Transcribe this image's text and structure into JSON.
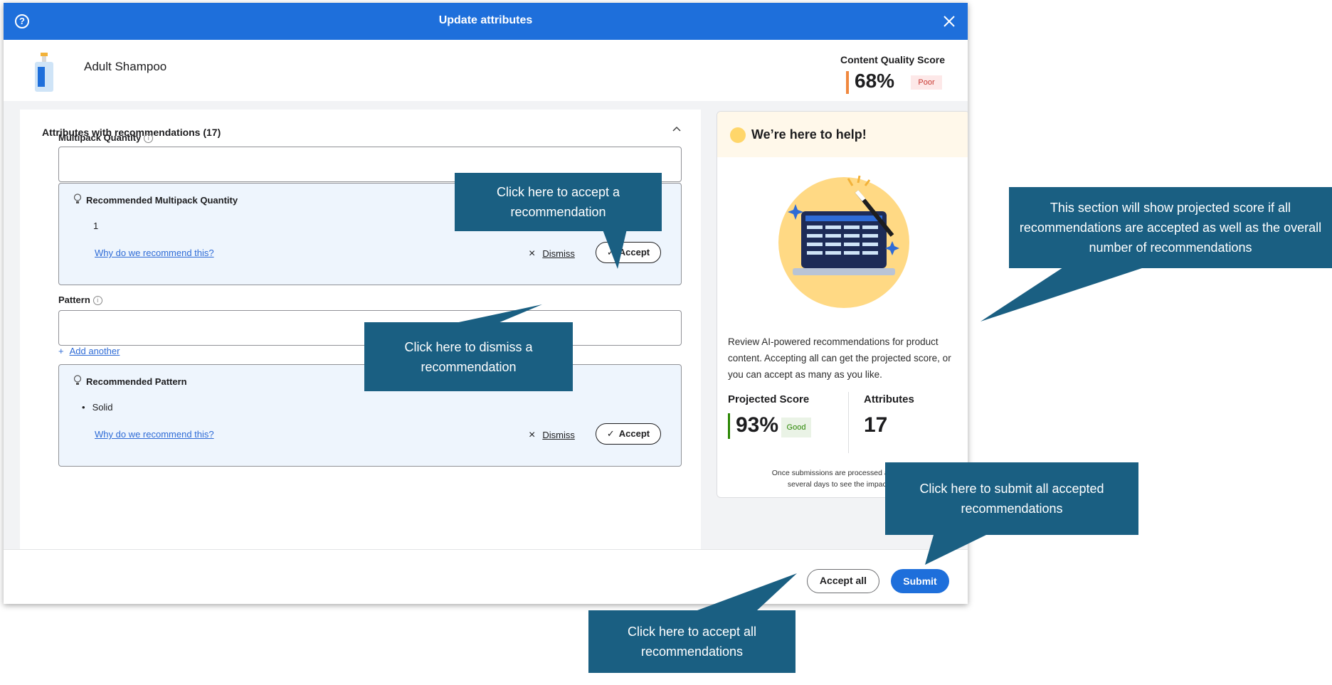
{
  "modal": {
    "title": "Update attributes",
    "help_icon": "?",
    "close_icon": "close-icon"
  },
  "product": {
    "name": "Adult Shampoo",
    "image_icon": "shampoo-bottle-icon"
  },
  "quality": {
    "label": "Content Quality Score",
    "value": "68%",
    "rating": "Poor",
    "color": "#f0883e"
  },
  "attributes": {
    "section_title": "Attributes with recommendations (17)",
    "fields": [
      {
        "label": "Multipack Quantity",
        "recommendation_title": "Recommended Multipack Quantity",
        "recommended_value": "1",
        "why_link": "Why do we recommend this?",
        "dismiss_label": "Dismiss",
        "accept_label": "Accept"
      },
      {
        "label": "Pattern",
        "add_another": "Add another",
        "recommendation_title": "Recommended Pattern",
        "recommended_value": "Solid",
        "why_link": "Why do we recommend this?",
        "dismiss_label": "Dismiss",
        "accept_label": "Accept"
      }
    ]
  },
  "help": {
    "title": "We’re here to help!",
    "description": "Review AI-powered recommendations for product content. Accepting all can get the projected score, or you can accept as many as you like.",
    "projected_label": "Projected Score",
    "projected_value": "93%",
    "projected_rating": "Good",
    "projected_color": "#2a8703",
    "attributes_label": "Attributes",
    "attributes_value": "17",
    "note_line1": "Once submissions are processed and compl",
    "note_line2": "several days to see the impact on t"
  },
  "footer": {
    "accept_all_label": "Accept all",
    "submit_label": "Submit"
  },
  "callouts": {
    "accept": "Click here to accept a recommendation",
    "dismiss": "Click here to dismiss a recommendation",
    "projected": "This section will show projected score if all recommendations are accepted as well as the overall number of recommendations",
    "submit": "Click here to submit all accepted recommendations",
    "accept_all": "Click here to accept all recommendations"
  },
  "colors": {
    "primary": "#1e6fdb",
    "callout": "#1a5f82",
    "recommendation_bg": "#eef5fd"
  }
}
